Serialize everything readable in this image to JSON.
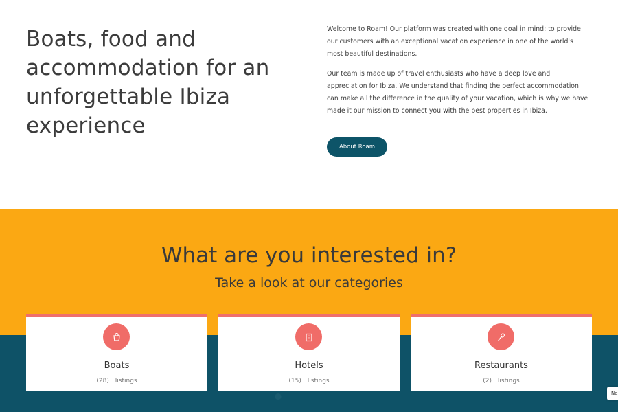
{
  "hero": {
    "title": "Boats, food and accommodation for an unforgettable Ibiza experience",
    "paragraphs": [
      "Welcome to Roam! Our platform was created with one goal in mind: to provide our customers with an exceptional vacation experience in one of the world's most beautiful destinations.",
      "Our team is made up of travel enthusiasts who have a deep love and appreciation for Ibiza. We understand that finding the perfect accommodation can make all the difference in the quality of your vacation, which is why we have made it our mission to connect you with the best properties in Ibiza."
    ],
    "button_label": "About Roam"
  },
  "categories": {
    "heading": "What are you interested in?",
    "subheading": "Take a look at our categories",
    "items": [
      {
        "name": "Boats",
        "count": "(28)",
        "count_label": "listings",
        "icon": "bag-icon"
      },
      {
        "name": "Hotels",
        "count": "(15)",
        "count_label": "listings",
        "icon": "building-icon"
      },
      {
        "name": "Restaurants",
        "count": "(2)",
        "count_label": "listings",
        "icon": "spoon-icon"
      }
    ]
  },
  "side_tab": {
    "label": "Ne"
  },
  "colors": {
    "primary": "#0d5468",
    "accent": "#f06c68",
    "yellow": "#fba813",
    "teal": "#0e5267"
  }
}
